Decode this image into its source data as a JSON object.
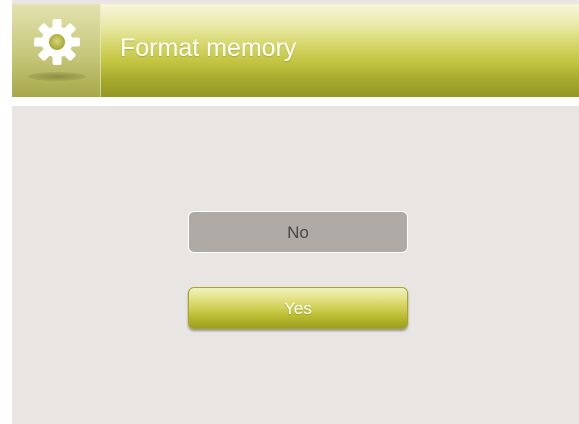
{
  "header": {
    "title": "Format memory",
    "icon": "gear-icon"
  },
  "dialog": {
    "no_label": "No",
    "yes_label": "Yes"
  },
  "colors": {
    "accent": "#c2c441",
    "background": "#e8e5e2",
    "button_neutral": "#afaaa6"
  }
}
